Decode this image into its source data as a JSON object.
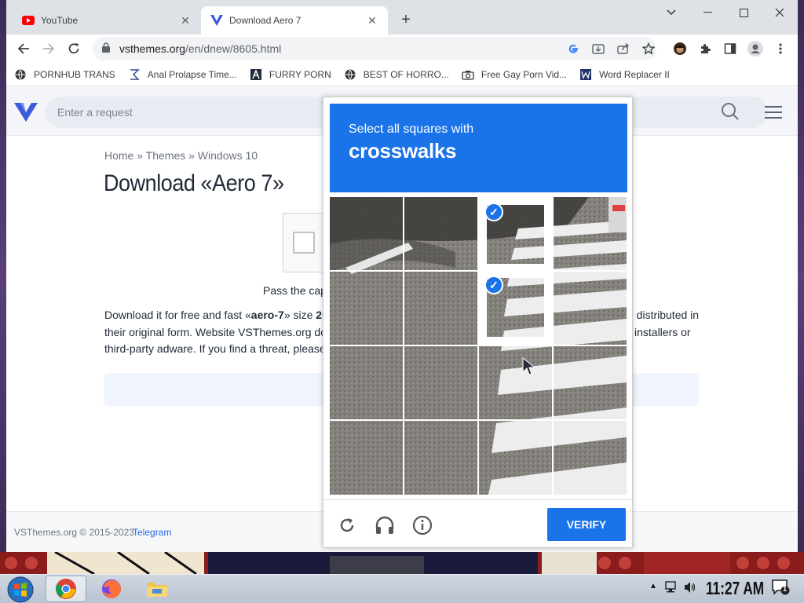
{
  "browser": {
    "tabs": [
      {
        "title": "YouTube",
        "icon": "youtube-icon",
        "active": false
      },
      {
        "title": "Download Aero 7",
        "icon": "vsthemes-icon",
        "active": true
      }
    ],
    "new_tab": "+",
    "window_controls": {
      "minimize": "—",
      "maximize": "☐",
      "close": "✕",
      "tablist": "⌄"
    },
    "url_host": "vsthemes.org",
    "url_path": "/en/dnew/8605.html",
    "bookmarks": [
      {
        "label": "PORNHUB TRANS",
        "icon": "globe-icon"
      },
      {
        "label": "Anal Prolapse Time...",
        "icon": "sigma-icon"
      },
      {
        "label": "FURRY PORN",
        "icon": "lambda-icon"
      },
      {
        "label": "BEST OF HORRO...",
        "icon": "globe-icon"
      },
      {
        "label": "Free Gay Porn Vid...",
        "icon": "camera-icon"
      },
      {
        "label": "Word Replacer II",
        "icon": "extension-icon"
      }
    ]
  },
  "site": {
    "search_placeholder": "Enter a request",
    "breadcrumb": "Home » Themes » Windows 10",
    "title": "Download «Aero 7»",
    "pass_text": "Pass the capt",
    "desc_line1_a": "Download it for free and fast «",
    "desc_line1_bold": "aero-7",
    "desc_line1_b": "» size ",
    "desc_line1_size": "20.0",
    "desc_line1_right": "e distributed in",
    "desc_line2_left": "their original form. Website VSThemes.org does",
    "desc_line2_right": "installers or",
    "desc_line3_left": "third-party adware. If you find a threat, please v",
    "footer_copy": "VSThemes.org © 2015-2023",
    "footer_link": "Telegram"
  },
  "captcha": {
    "prompt_small": "Select all squares with",
    "prompt_big": "crosswalks",
    "verify_label": "VERIFY",
    "selected_tiles": [
      2,
      6
    ],
    "accent": "#1a73e8"
  },
  "taskbar": {
    "clock": "11:27 AM",
    "notification_count": "1"
  }
}
